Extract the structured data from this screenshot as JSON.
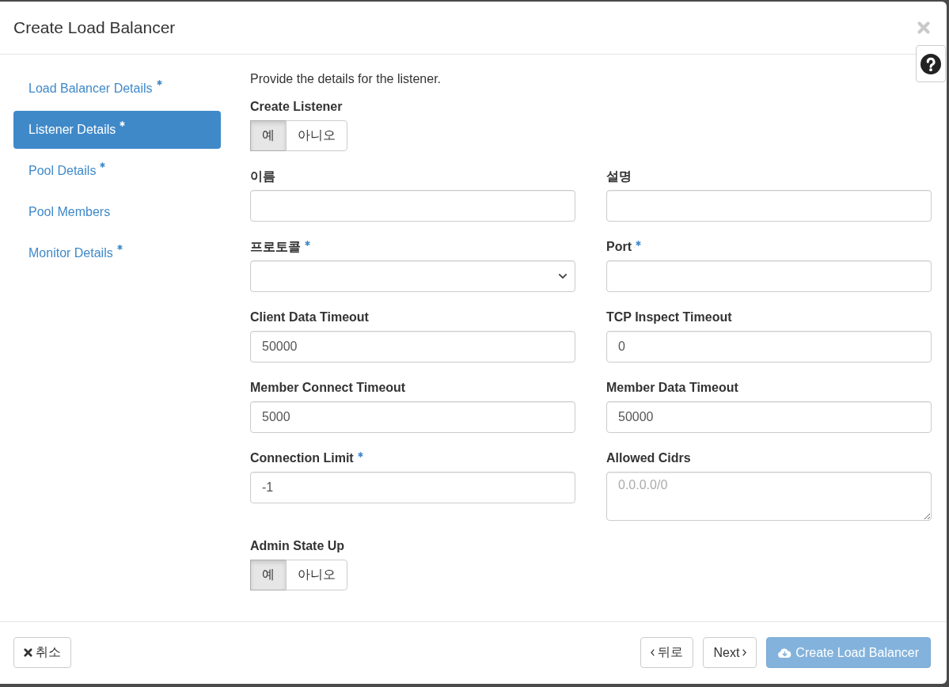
{
  "dialog": {
    "title": "Create Load Balancer"
  },
  "steps": [
    {
      "label": "Load Balancer Details",
      "required": true,
      "selected": false
    },
    {
      "label": "Listener Details",
      "required": true,
      "selected": true
    },
    {
      "label": "Pool Details",
      "required": true,
      "selected": false
    },
    {
      "label": "Pool Members",
      "required": false,
      "selected": false
    },
    {
      "label": "Monitor Details",
      "required": true,
      "selected": false
    }
  ],
  "form": {
    "description": "Provide the details for the listener.",
    "rows": [
      [
        {
          "kind": "toggle",
          "label": "Create Listener",
          "required": false,
          "options": [
            {
              "label": "예",
              "selected": true
            },
            {
              "label": "아니오",
              "selected": false
            }
          ]
        }
      ],
      [
        {
          "kind": "text",
          "label": "이름",
          "required": false
        },
        {
          "kind": "text",
          "label": "설명",
          "required": false
        }
      ],
      [
        {
          "kind": "select",
          "label": "프로토콜",
          "required": true
        },
        {
          "kind": "text",
          "label": "Port",
          "required": true
        }
      ],
      [
        {
          "kind": "text",
          "label": "Client Data Timeout",
          "required": false,
          "value": "50000"
        },
        {
          "kind": "text",
          "label": "TCP Inspect Timeout",
          "required": false,
          "value": "0"
        }
      ],
      [
        {
          "kind": "text",
          "label": "Member Connect Timeout",
          "required": false,
          "value": "5000"
        },
        {
          "kind": "text",
          "label": "Member Data Timeout",
          "required": false,
          "value": "50000"
        }
      ],
      [
        {
          "kind": "text",
          "label": "Connection Limit",
          "required": true,
          "value": "-1"
        },
        {
          "kind": "textarea",
          "label": "Allowed Cidrs",
          "required": false,
          "placeholder": "0.0.0.0/0"
        }
      ],
      [
        {
          "kind": "toggle",
          "label": "Admin State Up",
          "required": false,
          "options": [
            {
              "label": "예",
              "selected": true
            },
            {
              "label": "아니오",
              "selected": false
            }
          ]
        }
      ]
    ]
  },
  "footer": {
    "buttons": [
      {
        "kind": "cancel",
        "label": "취소",
        "disabled": false
      },
      {
        "kind": "back",
        "label": "뒤로",
        "disabled": false
      },
      {
        "kind": "next",
        "label": "Next",
        "disabled": false
      },
      {
        "kind": "submit",
        "label": "Create Load Balancer",
        "disabled": true
      }
    ]
  }
}
